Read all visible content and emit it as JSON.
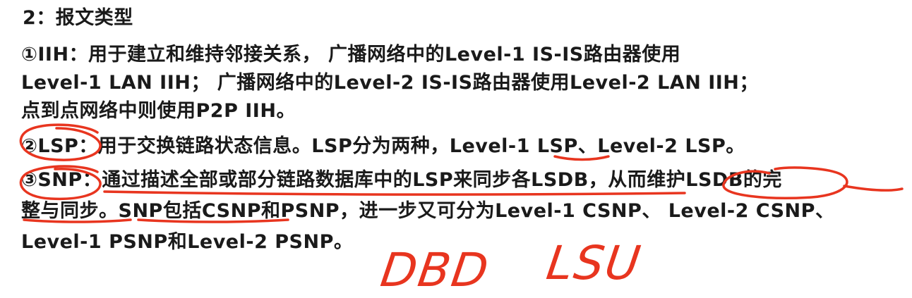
{
  "document": {
    "title": "2：报文类型",
    "lines": [
      "①IIH：用于建立和维持邻接关系， 广播网络中的Level-1 IS-IS路由器使用",
      "Level-1 LAN IIH； 广播网络中的Level-2 IS-IS路由器使用Level-2 LAN IIH；",
      "点到点网络中则使用P2P IIH。",
      "②LSP：用于交换链路状态信息。LSP分为两种，Level-1 LSP、Level-2 LSP。",
      "③SNP：通过描述全部或部分链路数据库中的LSP来同步各LSDB，从而维护LSDB的完",
      "整与同步。SNP包括CSNP和PSNP，进一步又可分为Level-1 CSNP、 Level-2 CSNP、",
      "Level-1 PSNP和Level-2 PSNP。"
    ]
  },
  "annotations": {
    "color": "#e8351f",
    "handwriting": [
      "DBD",
      "LSU"
    ]
  }
}
